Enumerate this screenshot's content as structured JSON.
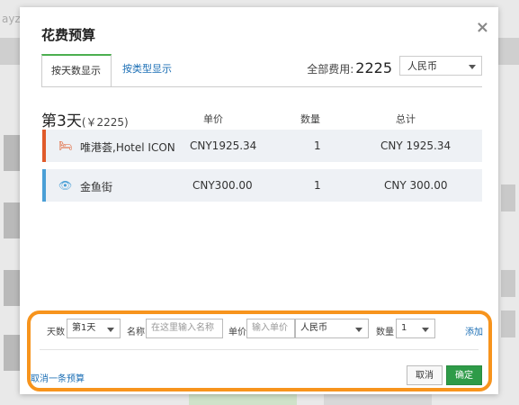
{
  "background": {
    "left_text": "ayz"
  },
  "dialog": {
    "title": "花费预算",
    "close_label": "×",
    "tabs": [
      {
        "label": "按天数显示",
        "active": true
      },
      {
        "label": "按类型显示",
        "active": false
      }
    ],
    "total": {
      "label": "全部费用:",
      "value": "2225"
    },
    "currency": "人民币",
    "day": {
      "title": "第3天",
      "subtotal": "(￥2225)"
    },
    "columns": {
      "unit_price": "单价",
      "quantity": "数量",
      "total": "总计"
    },
    "items": [
      {
        "icon": "hotel-bed-icon",
        "name": "唯港荟,Hotel ICON",
        "unit_price": "CNY1925.34",
        "quantity": "1",
        "total": "CNY 1925.34",
        "accent": "#e05a2a"
      },
      {
        "icon": "eye-icon",
        "name": "金鱼街",
        "unit_price": "CNY300.00",
        "quantity": "1",
        "total": "CNY 300.00",
        "accent": "#4a9fd6"
      }
    ],
    "editor": {
      "days_label": "天数",
      "days_value": "第1天",
      "name_label": "名称",
      "name_placeholder": "在这里输入名称",
      "price_label": "单价",
      "price_placeholder": "输入单价",
      "currency_value": "人民币",
      "qty_label": "数量",
      "qty_value": "1",
      "add_label": "添加"
    },
    "footer": {
      "cancel_budget_label": "取消一条预算",
      "cancel_button": "取消",
      "ok_button": "确定"
    },
    "highlight_color": "#f7941d"
  }
}
